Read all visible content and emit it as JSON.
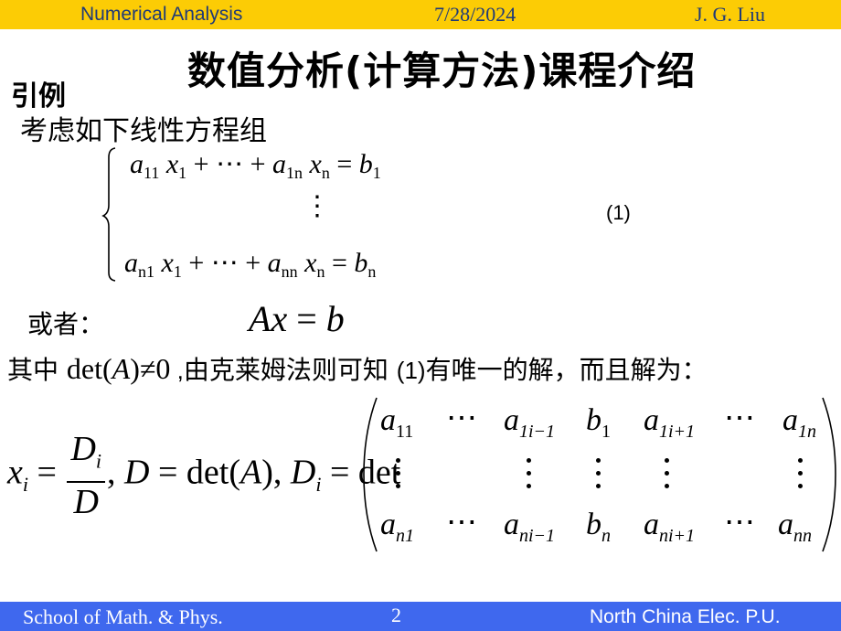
{
  "header": {
    "course": "Numerical Analysis",
    "date": "7/28/2024",
    "author": "J. G. Liu",
    "bg_color": "#fccc05",
    "text_color": "#1f3a78"
  },
  "footer": {
    "school": "School of Math. & Phys.",
    "page_number": "2",
    "university": "North China Elec. P.U.",
    "bg_color": "#3f68ee",
    "text_color": "#ffffff"
  },
  "slide": {
    "title": "数值分析(计算方法)课程介绍",
    "section_label": "引例",
    "intro_text": "考虑如下线性方程组",
    "system": {
      "row1": {
        "a": "a",
        "a_sub": "11",
        "x": "x",
        "x_sub": "1",
        "plus": "+",
        "cdots": "⋯",
        "plus2": "+",
        "a2": "a",
        "a2_sub": "1n",
        "x2": "x",
        "x2_sub": "n",
        "eq": "=",
        "b": "b",
        "b_sub": "1"
      },
      "vdots": "⋮",
      "row2": {
        "a": "a",
        "a_sub": "n1",
        "x": "x",
        "x_sub": "1",
        "plus": "+",
        "cdots": "⋯",
        "plus2": "+",
        "a2": "a",
        "a2_sub": "nn",
        "x2": "x",
        "x2_sub": "n",
        "eq": "=",
        "b": "b",
        "b_sub": "n"
      },
      "equation_number": "(1)"
    },
    "or_label": "或者：",
    "matrix_form": {
      "A": "A",
      "x": "x",
      "eq": " = ",
      "b": "b"
    },
    "condition": {
      "prefix": "其中 ",
      "det": "det(",
      "A": "A",
      "close": ")",
      "neq": "≠",
      "zero": "0",
      "comma": " ,",
      "text1": "由克莱姆法则可知 ",
      "ref": "(1)",
      "text2": "有唯一的解，而且解为："
    },
    "cramer": {
      "xi": "x",
      "i": "i",
      "eq": " = ",
      "num": "D",
      "num_sub": "i",
      "den": "D",
      "part2": ", ",
      "D": "D",
      "eq2": " = det(",
      "A": "A",
      "part3": "), ",
      "Di": "D",
      "Di_sub": "i",
      "eq3": " = det"
    },
    "matrix": {
      "row1": [
        {
          "base": "a",
          "sub": "11"
        },
        {
          "base": "⋯",
          "sub": ""
        },
        {
          "base": "a",
          "sub": "1i−1"
        },
        {
          "base": "b",
          "sub": "1"
        },
        {
          "base": "a",
          "sub": "1i+1"
        },
        {
          "base": "⋯",
          "sub": ""
        },
        {
          "base": "a",
          "sub": "1n"
        }
      ],
      "row3": [
        {
          "base": "a",
          "sub": "n1"
        },
        {
          "base": "⋯",
          "sub": ""
        },
        {
          "base": "a",
          "sub": "ni−1"
        },
        {
          "base": "b",
          "sub": "n"
        },
        {
          "base": "a",
          "sub": "ni+1"
        },
        {
          "base": "⋯",
          "sub": ""
        },
        {
          "base": "a",
          "sub": "nn"
        }
      ]
    }
  }
}
